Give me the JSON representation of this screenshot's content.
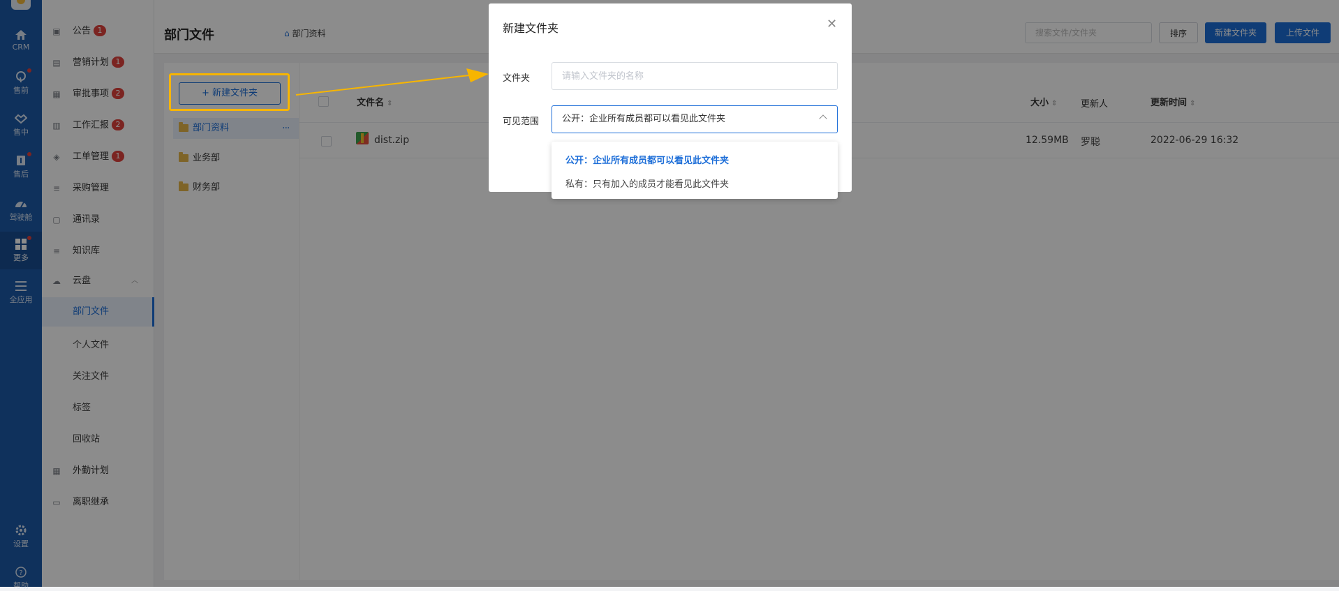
{
  "rail": {
    "items": [
      {
        "label": "CRM",
        "icon": "home-icon"
      },
      {
        "label": "售前",
        "icon": "pin-icon"
      },
      {
        "label": "售中",
        "icon": "handshake-icon"
      },
      {
        "label": "售后",
        "icon": "service-icon"
      },
      {
        "label": "驾驶舱",
        "icon": "dashboard-icon"
      },
      {
        "label": "更多",
        "icon": "grid-icon"
      },
      {
        "label": "全应用",
        "icon": "menu-icon"
      },
      {
        "label": "设置",
        "icon": "gear-icon"
      },
      {
        "label": "帮助",
        "icon": "help-icon"
      }
    ]
  },
  "menu": {
    "items": [
      {
        "label": "公告",
        "badge": "1"
      },
      {
        "label": "营销计划",
        "badge": "1"
      },
      {
        "label": "审批事项",
        "badge": "2"
      },
      {
        "label": "工作汇报",
        "badge": "2"
      },
      {
        "label": "工单管理",
        "badge": "1"
      },
      {
        "label": "采购管理"
      },
      {
        "label": "通讯录"
      },
      {
        "label": "知识库"
      },
      {
        "label": "云盘"
      },
      {
        "label": "部门文件"
      },
      {
        "label": "个人文件"
      },
      {
        "label": "关注文件"
      },
      {
        "label": "标签"
      },
      {
        "label": "回收站"
      },
      {
        "label": "外勤计划"
      },
      {
        "label": "离职继承"
      }
    ]
  },
  "header": {
    "title": "部门文件",
    "breadcrumb": "部门资料",
    "search_placeholder": "搜索文件/文件夹",
    "sort_label": "排序",
    "new_folder_label": "新建文件夹",
    "upload_label": "上传文件"
  },
  "folders": {
    "new_folder_label": "+ 新建文件夹",
    "items": [
      "部门资料",
      "业务部",
      "财务部"
    ],
    "more": "···"
  },
  "table": {
    "columns": {
      "name": "文件名",
      "size": "大小",
      "updater": "更新人",
      "updated": "更新时间"
    },
    "rows": [
      {
        "name": "dist.zip",
        "size": "12.59MB",
        "updater": "罗聪",
        "updated": "2022-06-29 16:32"
      }
    ]
  },
  "modal": {
    "title": "新建文件夹",
    "folder_label": "文件夹",
    "folder_placeholder": "请输入文件夹的名称",
    "scope_label": "可见范围",
    "scope_value": "公开：企业所有成员都可以看见此文件夹",
    "options": [
      "公开：企业所有成员都可以看见此文件夹",
      "私有：只有加入的成员才能看见此文件夹"
    ]
  },
  "colors": {
    "rail": "#1d5aa8",
    "accent": "#1d6ed8",
    "badge": "#e0423c",
    "highlight": "#f7b500"
  }
}
